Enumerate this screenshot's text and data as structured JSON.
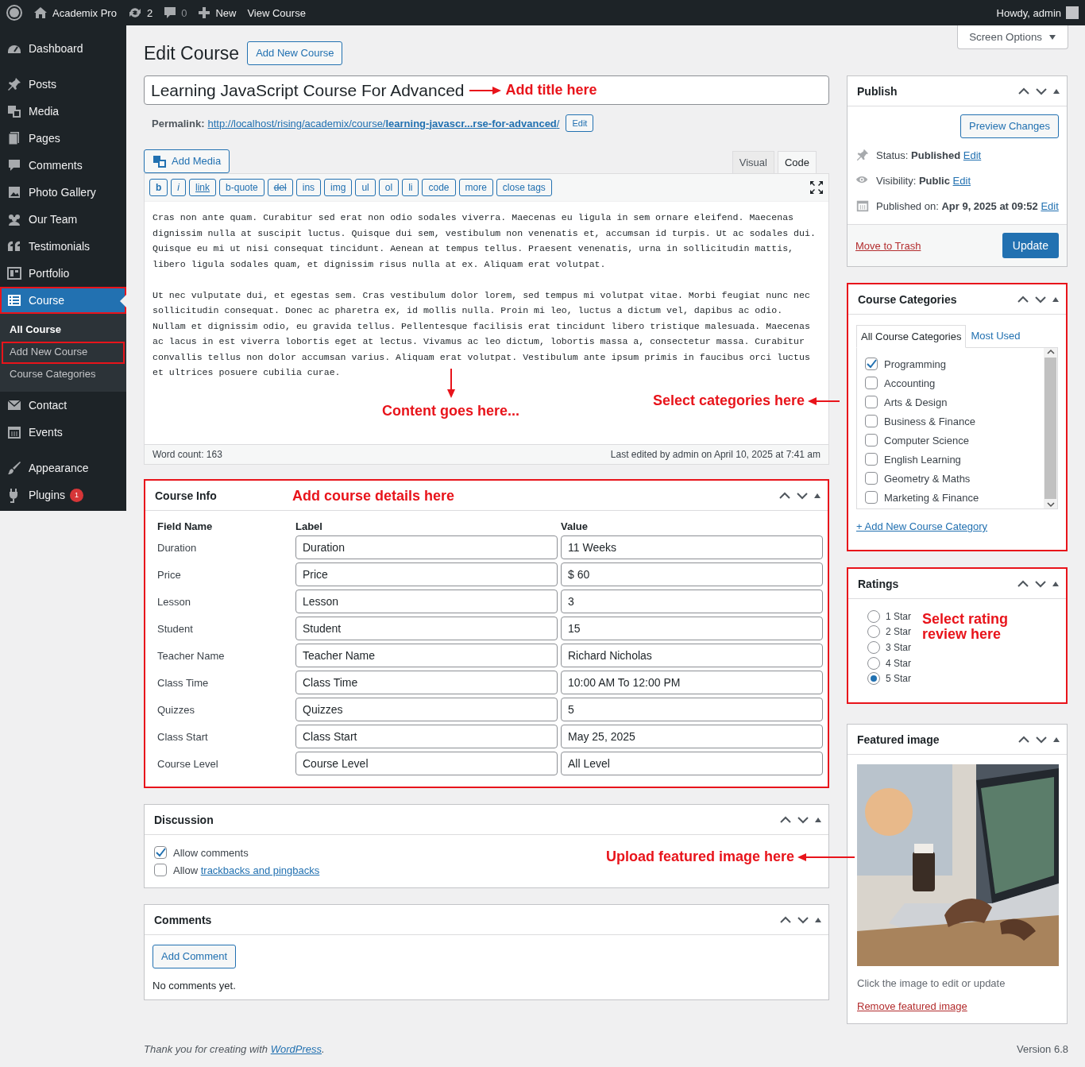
{
  "admin_bar": {
    "site_name": "Academix Pro",
    "updates": "2",
    "comments": "0",
    "new_label": "New",
    "view_label": "View Course",
    "greeting": "Howdy, admin"
  },
  "sidebar": {
    "groups": [
      [
        {
          "label": "Dashboard",
          "selected": false,
          "highlighted": false
        }
      ],
      [
        {
          "label": "Posts",
          "selected": false,
          "highlighted": false
        },
        {
          "label": "Media",
          "selected": false,
          "highlighted": false
        },
        {
          "label": "Pages",
          "selected": false,
          "highlighted": false
        },
        {
          "label": "Comments",
          "selected": false,
          "highlighted": false
        },
        {
          "label": "Photo Gallery",
          "selected": false,
          "highlighted": false
        },
        {
          "label": "Our Team",
          "selected": false,
          "highlighted": false
        },
        {
          "label": "Testimonials",
          "selected": false,
          "highlighted": false
        },
        {
          "label": "Portfolio",
          "selected": false,
          "highlighted": false
        },
        {
          "label": "Course",
          "selected": true,
          "highlighted": true,
          "children": [
            {
              "label": "All Course",
              "selected": true,
              "highlighted": false
            },
            {
              "label": "Add New Course",
              "selected": false,
              "highlighted": true
            },
            {
              "label": "Course Categories",
              "selected": false,
              "highlighted": false
            }
          ]
        },
        {
          "label": "Contact",
          "selected": false,
          "highlighted": false
        },
        {
          "label": "Events",
          "selected": false,
          "highlighted": false
        }
      ],
      [
        {
          "label": "Appearance",
          "selected": false,
          "highlighted": false
        },
        {
          "label": "Plugins",
          "selected": false,
          "highlighted": false,
          "badge": "1"
        }
      ]
    ]
  },
  "screen_options": "Screen Options",
  "heading": {
    "title": "Edit Course",
    "button": "Add New Course"
  },
  "title_field": {
    "value": "Learning JavaScript Course For Advanced"
  },
  "permalink": {
    "label": "Permalink:",
    "url": "http://localhost/rising/academix/course/**learning-javascr...rse-for-advanced**/",
    "button": "Edit"
  },
  "editor": {
    "add_media": "Add Media",
    "tabs": [
      {
        "label": "Visual",
        "selected": false
      },
      {
        "label": "Code",
        "selected": true
      }
    ],
    "toolbar": [
      "b",
      "i",
      "link",
      "b-quote",
      "del",
      "ins",
      "img",
      "ul",
      "ol",
      "li",
      "code",
      "more",
      "close tags"
    ],
    "paragraphs": [
      "Cras non ante quam. Curabitur sed erat non odio sodales viverra. Maecenas eu ligula in sem ornare eleifend. Maecenas dignissim nulla at suscipit luctus. Quisque dui sem, vestibulum non venenatis et, accumsan id turpis. Ut ac sodales dui. Quisque eu mi ut nisi consequat tincidunt. Aenean at tempus tellus. Praesent venenatis, urna in sollicitudin mattis, libero ligula sodales quam, et dignissim risus nulla at ex. Aliquam erat volutpat.",
      "Ut nec vulputate dui, et egestas sem. Cras vestibulum dolor lorem, sed tempus mi volutpat vitae. Morbi feugiat nunc nec sollicitudin consequat. Donec ac pharetra ex, id mollis nulla. Proin mi leo, luctus a dictum vel, dapibus ac odio. Nullam et dignissim odio, eu gravida tellus. Pellentesque facilisis erat tincidunt libero tristique malesuada. Maecenas ac lacus in est viverra lobortis eget at lectus. Vivamus ac leo dictum, lobortis massa a, consectetur massa. Curabitur convallis tellus non dolor accumsan varius. Aliquam erat volutpat. Vestibulum ante ipsum primis in faucibus orci luctus et ultrices posuere cubilia curae."
    ],
    "word_count": "Word count: 163",
    "last_edited": "Last edited by admin on April 10, 2025 at 7:41 am"
  },
  "course_info": {
    "title": "Course Info",
    "highlighted": true,
    "columns": [
      "Field Name",
      "Label",
      "Value"
    ],
    "rows": [
      {
        "field": "Duration",
        "label": "Duration",
        "value": "11 Weeks"
      },
      {
        "field": "Price",
        "label": "Price",
        "value": "$ 60"
      },
      {
        "field": "Lesson",
        "label": "Lesson",
        "value": "3"
      },
      {
        "field": "Student",
        "label": "Student",
        "value": "15"
      },
      {
        "field": "Teacher Name",
        "label": "Teacher Name",
        "value": "Richard Nicholas"
      },
      {
        "field": "Class Time",
        "label": "Class Time",
        "value": "10:00 AM To 12:00 PM"
      },
      {
        "field": "Quizzes",
        "label": "Quizzes",
        "value": "5"
      },
      {
        "field": "Class Start",
        "label": "Class Start",
        "value": "May 25, 2025"
      },
      {
        "field": "Course Level",
        "label": "Course Level",
        "value": "All Level"
      }
    ]
  },
  "discussion": {
    "title": "Discussion",
    "options": [
      {
        "text": "Allow comments",
        "checked": true
      },
      {
        "text": "Allow ",
        "link": "trackbacks and pingbacks",
        "checked": false
      }
    ]
  },
  "comments": {
    "title": "Comments",
    "button": "Add Comment",
    "empty": "No comments yet."
  },
  "publish": {
    "title": "Publish",
    "preview": "Preview Changes",
    "rows": [
      {
        "text": "Status: **Published**",
        "link": "Edit"
      },
      {
        "text": "Visibility: **Public**",
        "link": "Edit"
      },
      {
        "text": "Published on: **Apr 9, 2025 at 09:52**",
        "link": "Edit"
      }
    ],
    "trash": "Move to Trash",
    "update": "Update"
  },
  "categories": {
    "title": "Course Categories",
    "highlighted": true,
    "tabs": [
      {
        "label": "All Course Categories",
        "selected": true
      },
      {
        "label": "Most Used",
        "selected": false
      }
    ],
    "items": [
      {
        "label": "Programming",
        "checked": true
      },
      {
        "label": "Accounting",
        "checked": false
      },
      {
        "label": "Arts & Design",
        "checked": false
      },
      {
        "label": "Business & Finance",
        "checked": false
      },
      {
        "label": "Computer Science",
        "checked": false
      },
      {
        "label": "English Learning",
        "checked": false
      },
      {
        "label": "Geometry & Maths",
        "checked": false
      },
      {
        "label": "Marketing & Finance",
        "checked": false
      }
    ],
    "add_link": "+ Add New Course Category"
  },
  "ratings": {
    "title": "Ratings",
    "highlighted": true,
    "options": [
      {
        "label": "1 Star",
        "selected": false
      },
      {
        "label": "2 Star",
        "selected": false
      },
      {
        "label": "3 Star",
        "selected": false
      },
      {
        "label": "4 Star",
        "selected": false
      },
      {
        "label": "5 Star",
        "selected": true
      }
    ]
  },
  "featured_image": {
    "title": "Featured image",
    "caption": "Click the image to edit or update",
    "remove": "Remove featured image"
  },
  "annotations": [
    {
      "kind": "title",
      "text": "Add title here"
    },
    {
      "kind": "content",
      "text": "Content goes here..."
    },
    {
      "kind": "categories",
      "text": "Select categories here"
    },
    {
      "kind": "course_info",
      "text": "Add course details here"
    },
    {
      "kind": "rating",
      "text": "Select rating review here"
    },
    {
      "text": "Upload featured image here"
    }
  ],
  "footer": {
    "text": "Thank you for creating with ",
    "link": "WordPress",
    "after": ".",
    "version": "Version 6.8"
  }
}
